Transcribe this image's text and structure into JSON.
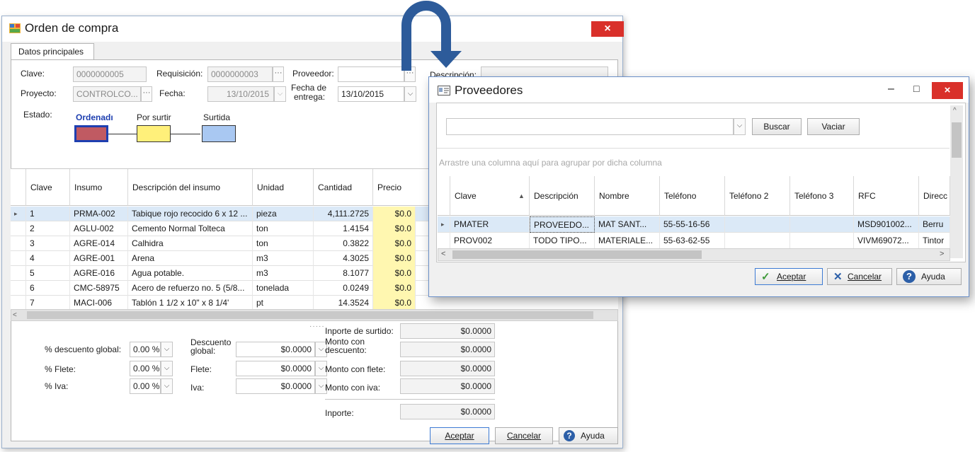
{
  "order": {
    "title": "Orden de compra",
    "close_label": "×",
    "tab": "Datos principales",
    "fields": {
      "clave_label": "Clave:",
      "clave_value": "0000000005",
      "requisicion_label": "Requisición:",
      "requisicion_value": "0000000003",
      "proveedor_label": "Proveedor:",
      "proveedor_value": "",
      "descripcion_label": "Descripción:",
      "proyecto_label": "Proyecto:",
      "proyecto_value": "CONTROLCO...",
      "fecha_label": "Fecha:",
      "fecha_value": "13/10/2015",
      "fecha_entrega_label_1": "Fecha de",
      "fecha_entrega_label_2": "entrega:",
      "fecha_entrega_value": "13/10/2015",
      "estado_label": "Estado:",
      "ellipsis": "···",
      "dropdown": "⌵"
    },
    "states": [
      {
        "label": "Ordenadı",
        "color": "#c05a62"
      },
      {
        "label": "Por surtir",
        "color": "#fff07a"
      },
      {
        "label": "Surtida",
        "color": "#a9c8f2"
      }
    ],
    "grid": {
      "headers": [
        "Clave",
        "Insumo",
        "Descripción del insumo",
        "Unidad",
        "Cantidad",
        "Precio"
      ],
      "rows": [
        {
          "clave": "1",
          "insumo": "PRMA-002",
          "descripcion": "Tabique rojo recocido 6 x 12 ...",
          "unidad": "pieza",
          "cantidad": "4,111.2725",
          "precio": "$0.0"
        },
        {
          "clave": "2",
          "insumo": "AGLU-002",
          "descripcion": "Cemento Normal Tolteca",
          "unidad": "ton",
          "cantidad": "1.4154",
          "precio": "$0.0"
        },
        {
          "clave": "3",
          "insumo": "AGRE-014",
          "descripcion": "Calhidra",
          "unidad": "ton",
          "cantidad": "0.3822",
          "precio": "$0.0"
        },
        {
          "clave": "4",
          "insumo": "AGRE-001",
          "descripcion": "Arena",
          "unidad": "m3",
          "cantidad": "4.3025",
          "precio": "$0.0"
        },
        {
          "clave": "5",
          "insumo": "AGRE-016",
          "descripcion": "Agua potable.",
          "unidad": "m3",
          "cantidad": "8.1077",
          "precio": "$0.0"
        },
        {
          "clave": "6",
          "insumo": "CMC-58975",
          "descripcion": "Acero de refuerzo no. 5 (5/8...",
          "unidad": "tonelada",
          "cantidad": "0.0249",
          "precio": "$0.0"
        },
        {
          "clave": "7",
          "insumo": "MACI-006",
          "descripcion": "Tablón 1 1/2 x 10\" x 8 1/4'",
          "unidad": "pt",
          "cantidad": "14.3524",
          "precio": "$0.0"
        }
      ],
      "row_indicator": "▸",
      "splitter": "·····"
    },
    "totals": {
      "descuento_global_pct_label": "% descuento global:",
      "descuento_global_pct": "0.00 %",
      "flete_pct_label": "% Flete:",
      "flete_pct": "0.00 %",
      "iva_pct_label": "% Iva:",
      "iva_pct": "0.00 %",
      "descuento_global_label_1": "Descuento",
      "descuento_global_label_2": "global:",
      "descuento_global": "$0.0000",
      "flete_label": "Flete:",
      "flete": "$0.0000",
      "iva_label": "Iva:",
      "iva": "$0.0000",
      "importe_surtido_label": "Inporte de surtido:",
      "importe_surtido": "$0.0000",
      "monto_descuento_label_1": "Monto con",
      "monto_descuento_label_2": "descuento:",
      "monto_descuento": "$0.0000",
      "monto_flete_label": "Monto con flete:",
      "monto_flete": "$0.0000",
      "monto_iva_label": "Monto con iva:",
      "monto_iva": "$0.0000",
      "importe_label": "Inporte:",
      "importe": "$0.0000"
    },
    "buttons": {
      "aceptar": "Aceptar",
      "cancelar": "Cancelar",
      "ayuda": "Ayuda"
    }
  },
  "providers": {
    "title": "Proveedores",
    "minimize": "–",
    "maximize": "□",
    "close": "×",
    "search_value": "",
    "buscar": "Buscar",
    "vaciar": "Vaciar",
    "group_hint": "Arrastre una columna aquí para agrupar por dicha columna",
    "headers": [
      "Clave",
      "Descripción",
      "Nombre",
      "Teléfono",
      "Teléfono 2",
      "Teléfono 3",
      "RFC",
      "Direcc"
    ],
    "sort_indicator": "▲",
    "rows": [
      {
        "clave": "PMATER",
        "descripcion": "PROVEEDO...",
        "nombre": "MAT SANT...",
        "telefono": "55-55-16-56",
        "telefono2": "",
        "telefono3": "",
        "rfc": "MSD901002...",
        "direccion": "Berru"
      },
      {
        "clave": "PROV002",
        "descripcion": "TODO TIPO...",
        "nombre": "MATERIALE...",
        "telefono": "55-63-62-55",
        "telefono2": "",
        "telefono3": "",
        "rfc": "VIVM69072...",
        "direccion": "Tintor"
      }
    ],
    "buttons": {
      "aceptar": "Aceptar",
      "cancelar": "Cancelar",
      "ayuda": "Ayuda"
    }
  },
  "colors": {
    "arrow": "#2d5b9a",
    "close": "#d9302a",
    "selected_row": "#dbe9f7",
    "price_cell": "#fff7b0"
  }
}
